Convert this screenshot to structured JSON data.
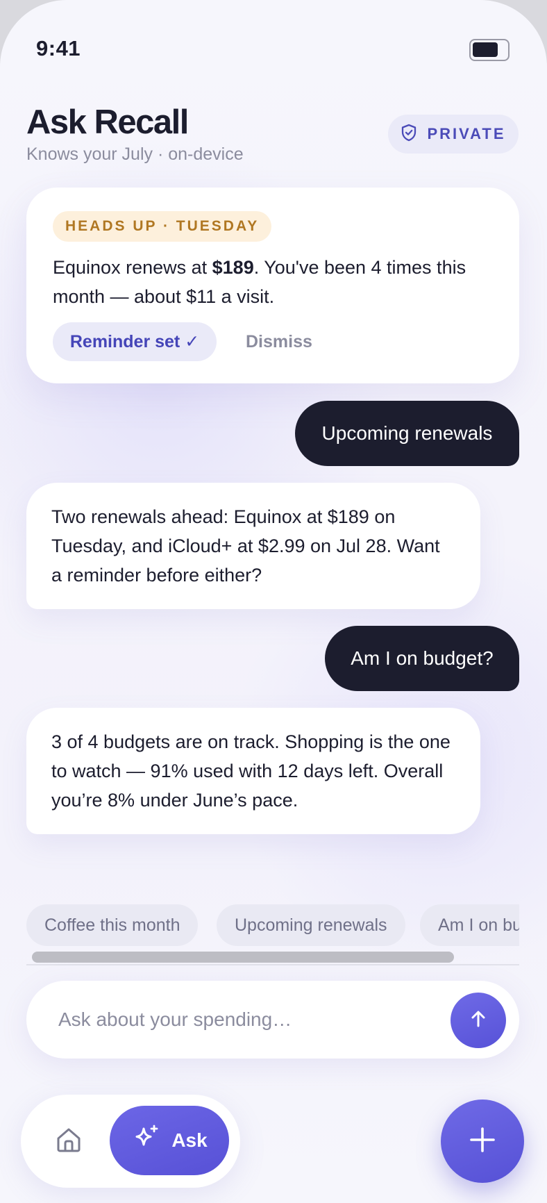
{
  "status_bar": {
    "time": "9:41"
  },
  "header": {
    "title": "Ask Recall",
    "subtitle": "Knows your July · on-device",
    "privacy_badge": "PRIVATE"
  },
  "alert": {
    "tag": "HEADS UP · TUESDAY",
    "text_pre": "Equinox renews at ",
    "text_amount": "$189",
    "text_post": ". You've been 4 times this month — about $11 a visit.",
    "reminder_button": "Reminder set ✓",
    "dismiss_button": "Dismiss"
  },
  "conversation": [
    {
      "role": "user",
      "text": "Upcoming renewals"
    },
    {
      "role": "assistant",
      "text": "Two renewals ahead: Equinox at $189 on Tuesday, and iCloud+ at $2.99 on Jul 28. Want a reminder before either?"
    },
    {
      "role": "user",
      "text": "Am I on budget?"
    },
    {
      "role": "assistant",
      "text": "3 of 4 budgets are on track. Shopping is the one to watch — 91% used with 12 days left. Overall you’re 8% under June’s pace."
    }
  ],
  "suggestions": [
    "Coffee this month",
    "Upcoming renewals",
    "Am I on budget?"
  ],
  "composer": {
    "placeholder": "Ask about your spending…",
    "value": ""
  },
  "nav": {
    "ask_label": "Ask"
  },
  "icons": {
    "privacy": "shield-check-icon",
    "send": "arrow-up-icon",
    "home": "home-icon",
    "ask": "sparkles-icon",
    "fab": "plus-icon"
  },
  "colors": {
    "accent": "#5b55dc",
    "user_bubble": "#1c1d2e",
    "alert_tag_bg": "#fdf0dc",
    "alert_tag_text": "#b07722"
  }
}
